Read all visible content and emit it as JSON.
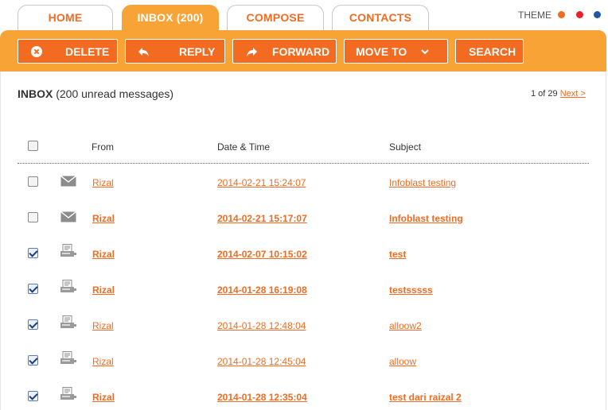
{
  "tabs": [
    {
      "label": "HOME",
      "active": false
    },
    {
      "label": "INBOX (200)",
      "active": true
    },
    {
      "label": "COMPOSE",
      "active": false
    },
    {
      "label": "CONTACTS",
      "active": false
    }
  ],
  "theme": {
    "label": "THEME",
    "colors": [
      "#f26b21",
      "#e8202a",
      "#1f57a5"
    ]
  },
  "toolbar": {
    "delete_label": "DELETE",
    "reply_label": "REPLY",
    "forward_label": "FORWARD",
    "move_to_label": "MOVE TO",
    "search_label": "SEARCH"
  },
  "inbox": {
    "title": "INBOX",
    "subtitle": "(200 unread messages)",
    "page_info": "1 of 29",
    "next_label": "Next >"
  },
  "columns": {
    "from": "From",
    "datetime": "Date & Time",
    "subject": "Subject"
  },
  "messages": [
    {
      "from": "Rizal",
      "datetime": "2014-02-21 15:24:07",
      "subject": "Infoblast testing",
      "checked": false,
      "unread": false,
      "icon": "envelope-icon"
    },
    {
      "from": "Rizal",
      "datetime": "2014-02-21 15:17:07",
      "subject": "Infoblast testing",
      "checked": false,
      "unread": true,
      "icon": "envelope-icon"
    },
    {
      "from": "Rizal",
      "datetime": "2014-02-07 10:15:02",
      "subject": "test",
      "checked": true,
      "unread": true,
      "icon": "fax-icon"
    },
    {
      "from": "Rizal",
      "datetime": "2014-01-28 16:19:08",
      "subject": "testsssss",
      "checked": true,
      "unread": true,
      "icon": "fax-icon"
    },
    {
      "from": "Rizal",
      "datetime": "2014-01-28 12:48:04",
      "subject": "alloow2",
      "checked": true,
      "unread": false,
      "icon": "fax-icon"
    },
    {
      "from": "Rizal",
      "datetime": "2014-01-28 12:45:04",
      "subject": "alloow",
      "checked": true,
      "unread": false,
      "icon": "fax-icon"
    },
    {
      "from": "Rizal",
      "datetime": "2014-01-28 12:35:04",
      "subject": "test dari raizal 2",
      "checked": true,
      "unread": true,
      "icon": "fax-icon"
    }
  ]
}
